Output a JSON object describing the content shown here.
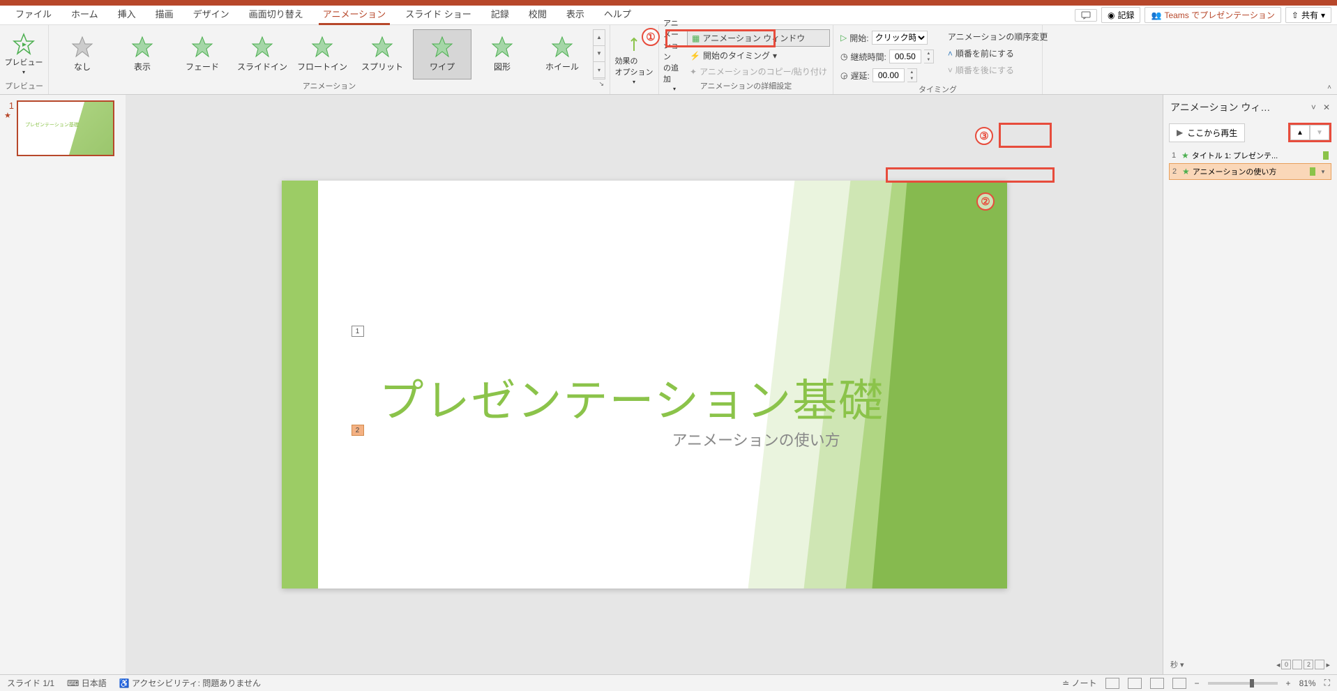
{
  "tabs": [
    "ファイル",
    "ホーム",
    "挿入",
    "描画",
    "デザイン",
    "画面切り替え",
    "アニメーション",
    "スライド ショー",
    "記録",
    "校閲",
    "表示",
    "ヘルプ"
  ],
  "active_tab": "アニメーション",
  "top_right": {
    "record": "記録",
    "teams": "Teams でプレゼンテーション",
    "share": "共有"
  },
  "ribbon": {
    "preview": {
      "label": "プレビュー",
      "btn": "プレビュー"
    },
    "gallery": {
      "label": "アニメーション",
      "items": [
        "なし",
        "表示",
        "フェード",
        "スライドイン",
        "フロートイン",
        "スプリット",
        "ワイプ",
        "図形",
        "ホイール"
      ],
      "selected": "ワイプ"
    },
    "effect": {
      "btn": "効果の\nオプション",
      "label": ""
    },
    "advanced": {
      "add": "アニメーション\nの追加",
      "pane": "アニメーション ウィンドウ",
      "trigger": "開始のタイミング",
      "copy": "アニメーションのコピー/貼り付け",
      "label": "アニメーションの詳細設定"
    },
    "timing": {
      "start_label": "開始:",
      "start_value": "クリック時",
      "duration_label": "継続時間:",
      "duration_value": "00.50",
      "delay_label": "遅延:",
      "delay_value": "00.00",
      "reorder_label": "アニメーションの順序変更",
      "move_earlier": "順番を前にする",
      "move_later": "順番を後にする",
      "label": "タイミング"
    }
  },
  "thumb": {
    "num": "1",
    "title": "プレゼンテーション基礎"
  },
  "slide": {
    "title": "プレゼンテーション基礎",
    "sub": "アニメーションの使い方",
    "tag1": "1",
    "tag2": "2"
  },
  "animpane": {
    "title": "アニメーション ウィ…",
    "play": "ここから再生",
    "items": [
      {
        "idx": "1",
        "label": "タイトル 1: プレゼンテ..."
      },
      {
        "idx": "2",
        "label": "アニメーションの使い方"
      }
    ],
    "seconds": "秒",
    "ruler": [
      "0",
      "",
      "2",
      ""
    ]
  },
  "status": {
    "slide": "スライド 1/1",
    "lang": "日本語",
    "access": "アクセシビリティ: 問題ありません",
    "notes": "ノート",
    "zoom": "81%"
  },
  "callouts": {
    "c1": "①",
    "c2": "②",
    "c3": "③"
  }
}
